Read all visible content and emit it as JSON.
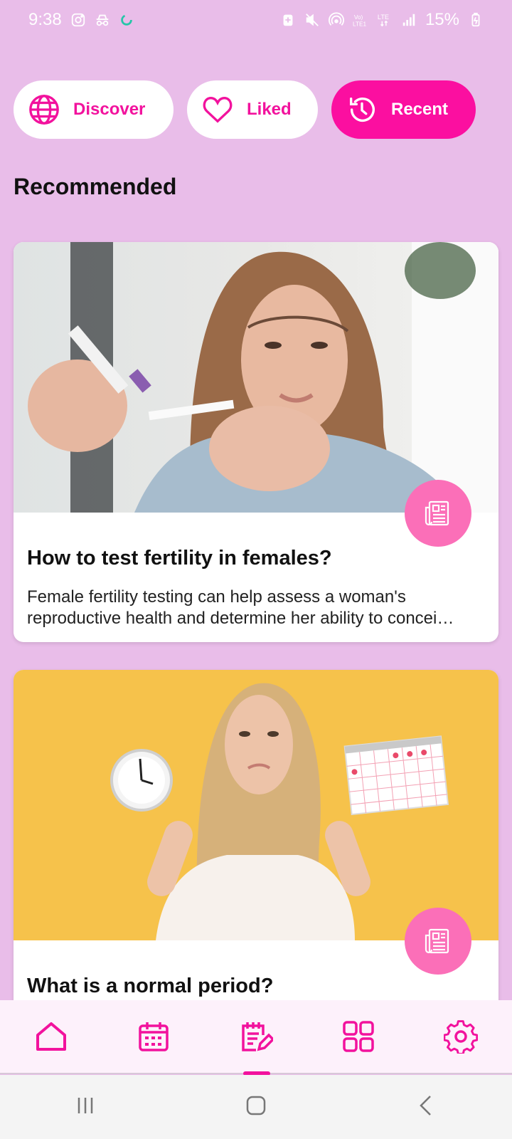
{
  "status_bar": {
    "time": "9:38",
    "battery": "15%",
    "left_icons": [
      "instagram-icon",
      "incognito-icon",
      "sync-icon"
    ],
    "right_icons": [
      "battery-saver-icon",
      "mute-icon",
      "hotspot-icon",
      "volte-icon",
      "lte-icon",
      "signal-icon"
    ]
  },
  "filters": [
    {
      "label": "Discover",
      "icon": "globe-icon",
      "active": false
    },
    {
      "label": "Liked",
      "icon": "heart-icon",
      "active": false
    },
    {
      "label": "Recent",
      "icon": "history-icon",
      "active": true
    }
  ],
  "section_title": "Recommended",
  "cards": [
    {
      "title": "How to test fertility in females?",
      "description": "Female fertility testing can help assess a woman's reproductive health and determine her ability to concei…",
      "icon": "article-icon"
    },
    {
      "title": "What is a normal period?",
      "description": "",
      "icon": "article-icon"
    }
  ],
  "bottom_nav": [
    {
      "name": "home",
      "icon": "home-icon"
    },
    {
      "name": "calendar",
      "icon": "calendar-icon"
    },
    {
      "name": "articles",
      "icon": "notes-icon",
      "active": true
    },
    {
      "name": "apps",
      "icon": "grid-icon"
    },
    {
      "name": "settings",
      "icon": "gear-icon"
    }
  ],
  "colors": {
    "background": "#e9bde9",
    "accent": "#f2129d",
    "accent_light": "#fb6fb8"
  }
}
